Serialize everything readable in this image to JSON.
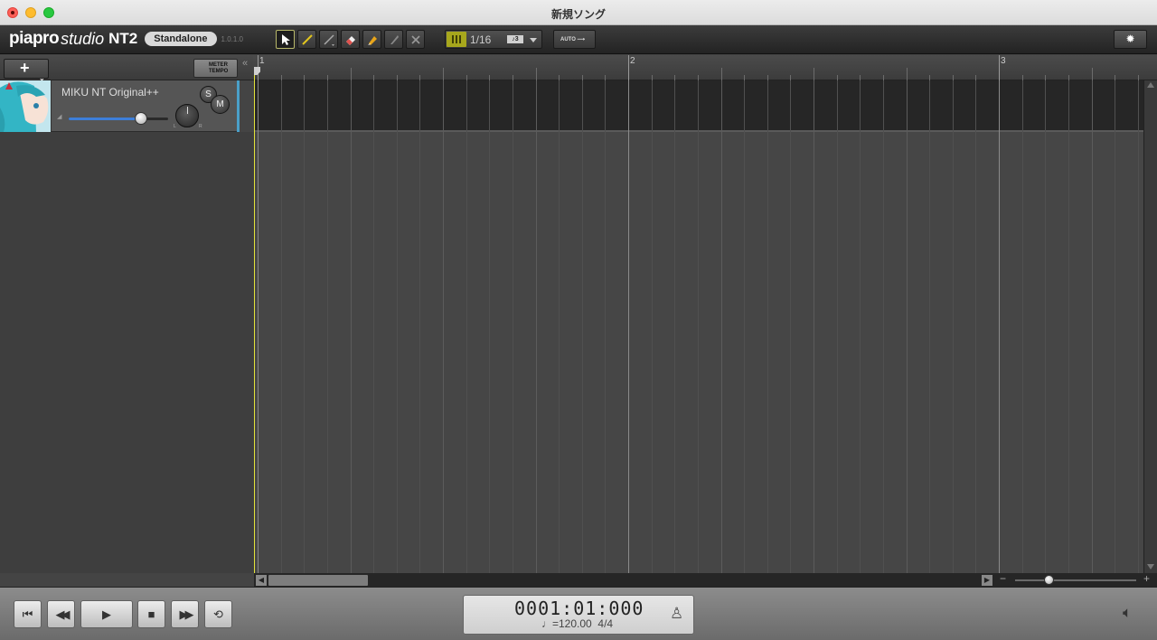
{
  "window": {
    "title": "新規ソング"
  },
  "toolbar": {
    "logo_word": "piapro",
    "logo_script": "studio",
    "logo_nt": "NT2",
    "edition_badge": "Standalone",
    "version": "1.0.1.0",
    "tools": [
      {
        "name": "select-tool",
        "icon": "arrow-cursor-icon",
        "active": true
      },
      {
        "name": "pencil-tool",
        "icon": "pencil-icon",
        "active": false
      },
      {
        "name": "line-tool",
        "icon": "line-icon",
        "active": false
      },
      {
        "name": "eraser-tool",
        "icon": "eraser-icon",
        "active": false
      },
      {
        "name": "highlighter-tool",
        "icon": "highlighter-icon",
        "active": false
      },
      {
        "name": "knife-tool",
        "icon": "knife-icon",
        "active": false
      },
      {
        "name": "mute-tool",
        "icon": "x-icon",
        "active": false
      }
    ],
    "snap_value": "1/16",
    "snap_triplet": "♪3",
    "auto_label": "AUTO",
    "settings_icon": "gear-icon"
  },
  "track_header": {
    "add_label": "+",
    "meter_label": "METER",
    "tempo_label": "TEMPO",
    "collapse_label": "«"
  },
  "ruler": {
    "bars": [
      "1",
      "2",
      "3"
    ]
  },
  "track": {
    "name": "MIKU NT Original++",
    "solo_label": "S",
    "mute_label": "M",
    "pan_left": "L",
    "pan_right": "R",
    "volume_level": 0.73
  },
  "transport": {
    "buttons": [
      {
        "name": "go-to-start-button",
        "icon": "skip-start-icon",
        "glyph": "⏮"
      },
      {
        "name": "rewind-button",
        "icon": "rewind-icon",
        "glyph": "◀◀"
      },
      {
        "name": "play-button",
        "icon": "play-icon",
        "glyph": "▶"
      },
      {
        "name": "stop-button",
        "icon": "stop-icon",
        "glyph": "■"
      },
      {
        "name": "fast-forward-button",
        "icon": "fast-forward-icon",
        "glyph": "▶▶"
      },
      {
        "name": "loop-button",
        "icon": "loop-icon",
        "glyph": "⟲"
      }
    ],
    "time": "0001:01:000",
    "tempo": "♩=120.00",
    "meter": "4/4",
    "metronome_icon": "metronome-icon",
    "speaker_icon": "speaker-icon"
  },
  "colors": {
    "accent_playhead": "#e2e23a",
    "track_edge": "#4aa0c9",
    "snap_icon": "#a7a71c",
    "volume_fill": "#3d7ed9"
  }
}
